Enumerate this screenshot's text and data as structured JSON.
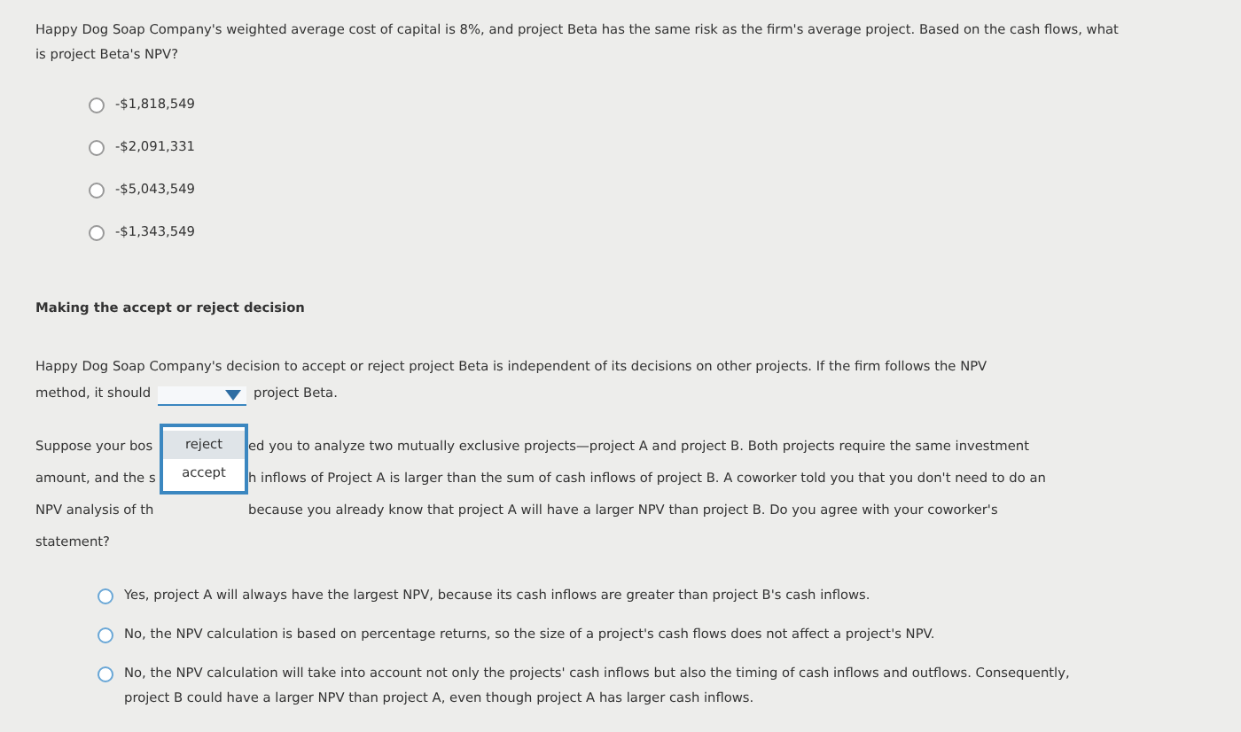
{
  "question1": {
    "text": "Happy Dog Soap Company's weighted average cost of capital is 8%, and project Beta has the same risk as the firm's average project. Based on the cash flows, what is project Beta's NPV?",
    "options": [
      {
        "label": "-$1,818,549",
        "selected": false
      },
      {
        "label": "-$2,091,331",
        "selected": false
      },
      {
        "label": "-$5,043,549",
        "selected": false
      },
      {
        "label": "-$1,343,549",
        "selected": false
      }
    ]
  },
  "section_heading": "Making the accept or reject decision",
  "decision": {
    "text_line1": "Happy Dog Soap Company's decision to accept or reject project Beta is independent of its decisions on other projects. If the firm follows the NPV",
    "text_before": "method, it should",
    "text_after": "project Beta.",
    "dropdown": {
      "expanded": true,
      "options": [
        {
          "label": "reject",
          "highlighted": true
        },
        {
          "label": "accept",
          "highlighted": false
        }
      ]
    }
  },
  "question2": {
    "lines": [
      {
        "left": "Suppose your bos",
        "right": "ed you to analyze two mutually exclusive projects—project A and project B. Both projects require the same investment"
      },
      {
        "left": "amount, and the s",
        "right": "h inflows of Project A is larger than the sum of cash inflows of project B. A coworker told you that you don't need to do an"
      },
      {
        "left": "NPV analysis of th",
        "right": "because you already know that project A will have a larger NPV than project B. Do you agree with your coworker's"
      }
    ],
    "last_line": "statement?",
    "options": [
      {
        "label": "Yes, project A will always have the largest NPV, because its cash inflows are greater than project B's cash inflows.",
        "selected": false
      },
      {
        "label": "No, the NPV calculation is based on percentage returns, so the size of a project's cash flows does not affect a project's NPV.",
        "selected": false
      },
      {
        "label": "No, the NPV calculation will take into account not only the projects' cash inflows but also the timing of cash inflows and outflows. Consequently, project B could have a larger NPV than project A, even though project A has larger cash inflows.",
        "selected": false
      }
    ]
  }
}
